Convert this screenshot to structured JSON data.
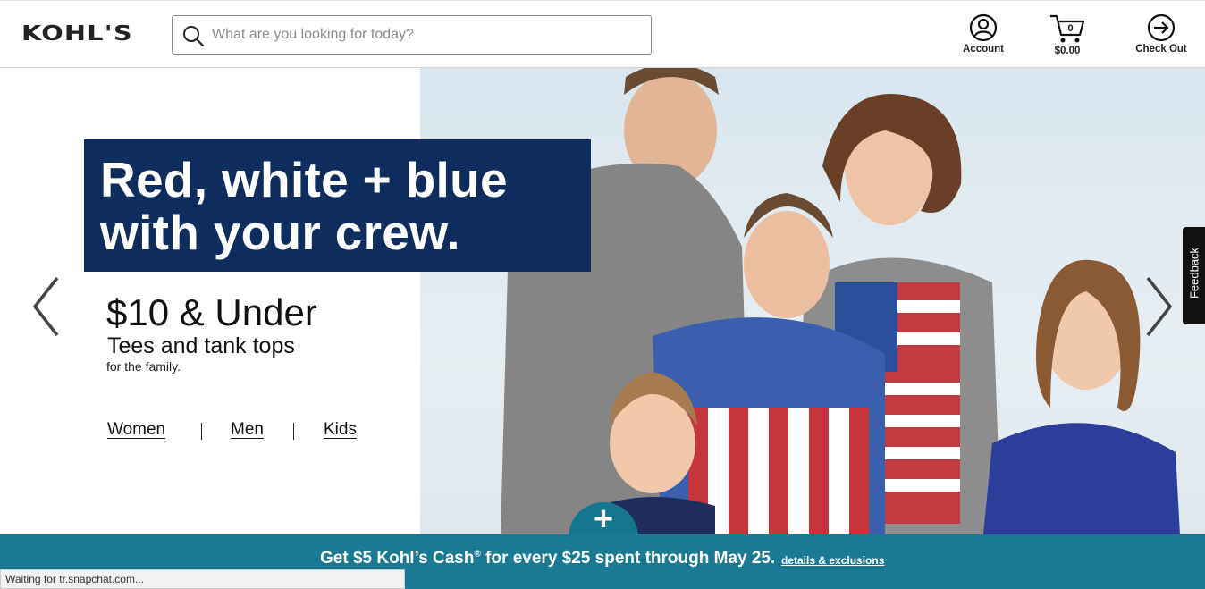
{
  "header": {
    "logo": "KOHL'S",
    "search_placeholder": "What are you looking for today?",
    "account_label": "Account",
    "cart_count": "0",
    "cart_total": "$0.00",
    "checkout_label": "Check Out"
  },
  "hero": {
    "headline_line1": "Red, white + blue",
    "headline_line2": "with your crew.",
    "promo_title": "$10 & Under",
    "promo_subtitle": "Tees and tank tops",
    "promo_small": "for the family.",
    "links": [
      "Women",
      "Men",
      "Kids"
    ],
    "feedback_label": "Feedback",
    "plus_label": "+"
  },
  "banner": {
    "text": "Get $5 Kohl’s Cash",
    "reg": "®",
    "text_rest": " for every $25 spent through May 25.",
    "link": "details & exclusions"
  },
  "status_bar": {
    "text": "Waiting for tr.snapchat.com..."
  },
  "colors": {
    "headline_bg": "#0f2d5c",
    "banner_bg": "#1a7a94",
    "plus_bg": "#15768f"
  }
}
